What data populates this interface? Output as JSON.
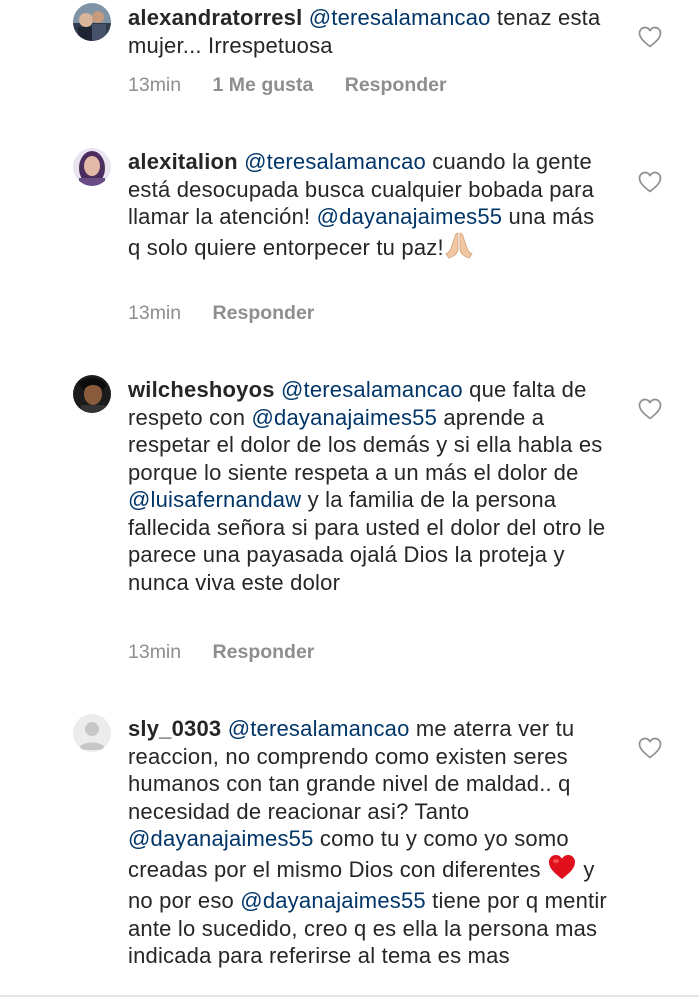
{
  "comments": [
    {
      "username": "alexandratorresl",
      "segments": [
        {
          "text": "@teresalamancao",
          "mention": true
        },
        {
          "text": " tenaz esta mujer... Irrespetuosa",
          "mention": false
        }
      ],
      "time": "13min",
      "likes": "1 Me gusta",
      "reply": "Responder"
    },
    {
      "username": "alexitalion",
      "segments": [
        {
          "text": "@teresalamancao",
          "mention": true
        },
        {
          "text": " cuando la gente está desocupada busca cualquier bobada para llamar la atención! ",
          "mention": false
        },
        {
          "text": "@dayanajaimes55",
          "mention": true
        },
        {
          "text": " una más q solo quiere entorpecer tu paz!",
          "mention": false
        }
      ],
      "emoji": "folded-hands",
      "time": "13min",
      "reply": "Responder"
    },
    {
      "username": "wilcheshoyos",
      "segments": [
        {
          "text": "@teresalamancao",
          "mention": true
        },
        {
          "text": " que falta de respeto con ",
          "mention": false
        },
        {
          "text": "@dayanajaimes55",
          "mention": true
        },
        {
          "text": " aprende a respetar el dolor de los demás y si ella habla es porque lo siente respeta a un más el dolor de ",
          "mention": false
        },
        {
          "text": "@luisafernandaw",
          "mention": true
        },
        {
          "text": " y la familia de la persona fallecida señora si para usted el dolor del otro le parece una payasada ojalá Dios la proteja y nunca viva este dolor",
          "mention": false
        }
      ],
      "time": "13min",
      "reply": "Responder"
    },
    {
      "username": "sly_0303",
      "segments": [
        {
          "text": "@teresalamancao",
          "mention": true
        },
        {
          "text": " me aterra ver tu reaccion, no comprendo como existen seres humanos con tan grande nivel de maldad.. q necesidad de reacionar asi? Tanto ",
          "mention": false
        },
        {
          "text": "@dayanajaimes55",
          "mention": true
        },
        {
          "text": " como tu y como yo somo creadas por el mismo Dios con diferentes ",
          "mention": false
        },
        {
          "text": "❤️",
          "mention": false,
          "heart": true
        },
        {
          "text": "  y no por eso ",
          "mention": false
        },
        {
          "text": "@dayanajaimes55",
          "mention": true
        },
        {
          "text": " tiene por q mentir ante lo sucedido, creo q es ella la persona mas indicada para referirse al tema es mas",
          "mention": false
        }
      ]
    }
  ],
  "colors": {
    "text": "#262626",
    "mention": "#003569",
    "meta": "#8e8e8e",
    "heart_emoji": "#e0101c"
  }
}
